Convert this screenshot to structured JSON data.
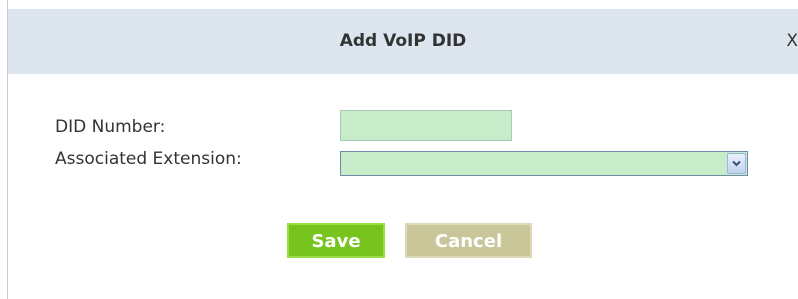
{
  "dialog": {
    "title": "Add VoIP DID",
    "close_label": "X"
  },
  "form": {
    "did_number": {
      "label": "DID Number:",
      "value": ""
    },
    "associated_extension": {
      "label": "Associated Extension:",
      "selected_value": ""
    }
  },
  "buttons": {
    "save_label": "Save",
    "cancel_label": "Cancel"
  },
  "icons": {
    "dropdown": "chevron-down-icon"
  },
  "colors": {
    "titlebar_bg": "#dde6ef",
    "field_bg": "#c7ecc9",
    "save_bg": "#77c41f",
    "cancel_bg": "#c9c79a"
  }
}
